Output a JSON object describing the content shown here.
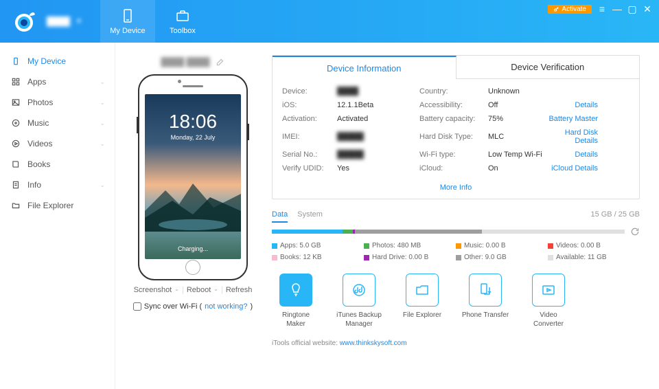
{
  "header": {
    "activate": "Activate",
    "tabs": [
      {
        "label": "My Device"
      },
      {
        "label": "Toolbox"
      }
    ]
  },
  "sidebar": {
    "items": [
      {
        "label": "My Device",
        "active": true,
        "expandable": false
      },
      {
        "label": "Apps",
        "expandable": true
      },
      {
        "label": "Photos",
        "expandable": true
      },
      {
        "label": "Music",
        "expandable": true
      },
      {
        "label": "Videos",
        "expandable": true
      },
      {
        "label": "Books",
        "expandable": false
      },
      {
        "label": "Info",
        "expandable": true
      },
      {
        "label": "File Explorer",
        "expandable": false
      }
    ]
  },
  "phone": {
    "time": "18:06",
    "date": "Monday, 22 July",
    "charging": "Charging...",
    "actions": {
      "screenshot": "Screenshot",
      "reboot": "Reboot",
      "refresh": "Refresh"
    },
    "sync_label": "Sync over Wi-Fi (",
    "sync_link": "not working?",
    "sync_close": ")"
  },
  "devicetabs": {
    "info": "Device Information",
    "verify": "Device Verification"
  },
  "info": {
    "device_label": "Device:",
    "ios_label": "iOS:",
    "ios_val": "12.1.1Beta",
    "activation_label": "Activation:",
    "activation_val": "Activated",
    "imei_label": "IMEI:",
    "serial_label": "Serial No.:",
    "verify_label": "Verify UDID:",
    "verify_val": "Yes",
    "country_label": "Country:",
    "country_val": "Unknown",
    "access_label": "Accessibility:",
    "access_val": "Off",
    "battery_label": "Battery capacity:",
    "battery_val": "75%",
    "hdtype_label": "Hard Disk Type:",
    "hdtype_val": "MLC",
    "wifi_label": "Wi-Fi type:",
    "wifi_val": "Low Temp Wi-Fi",
    "icloud_label": "iCloud:",
    "icloud_val": "On",
    "details": "Details",
    "battery_link": "Battery Master",
    "hd_link": "Hard Disk Details",
    "icloud_link": "iCloud Details",
    "more": "More Info"
  },
  "storage": {
    "data_tab": "Data",
    "system_tab": "System",
    "total": "15 GB / 25 GB",
    "segments": [
      {
        "color": "#29b6f6",
        "pct": 20
      },
      {
        "color": "#4caf50",
        "pct": 3
      },
      {
        "color": "#9c27b0",
        "pct": 0.5
      },
      {
        "color": "#9e9e9e",
        "pct": 36
      }
    ],
    "legend": [
      {
        "color": "#29b6f6",
        "label": "Apps: 5.0 GB"
      },
      {
        "color": "#4caf50",
        "label": "Photos: 480 MB"
      },
      {
        "color": "#ff9800",
        "label": "Music: 0.00 B"
      },
      {
        "color": "#f44336",
        "label": "Videos: 0.00 B"
      },
      {
        "color": "#f8bbd0",
        "label": "Books: 12 KB"
      },
      {
        "color": "#9c27b0",
        "label": "Hard Drive: 0.00 B"
      },
      {
        "color": "#9e9e9e",
        "label": "Other: 9.0 GB"
      },
      {
        "color": "#e0e0e0",
        "label": "Available: 11 GB"
      }
    ]
  },
  "tools": [
    {
      "label": "Ringtone Maker"
    },
    {
      "label": "iTunes Backup Manager"
    },
    {
      "label": "File Explorer"
    },
    {
      "label": "Phone Transfer"
    },
    {
      "label": "Video Converter"
    }
  ],
  "footer": {
    "text": "iTools official website: ",
    "link": "www.thinkskysoft.com"
  }
}
